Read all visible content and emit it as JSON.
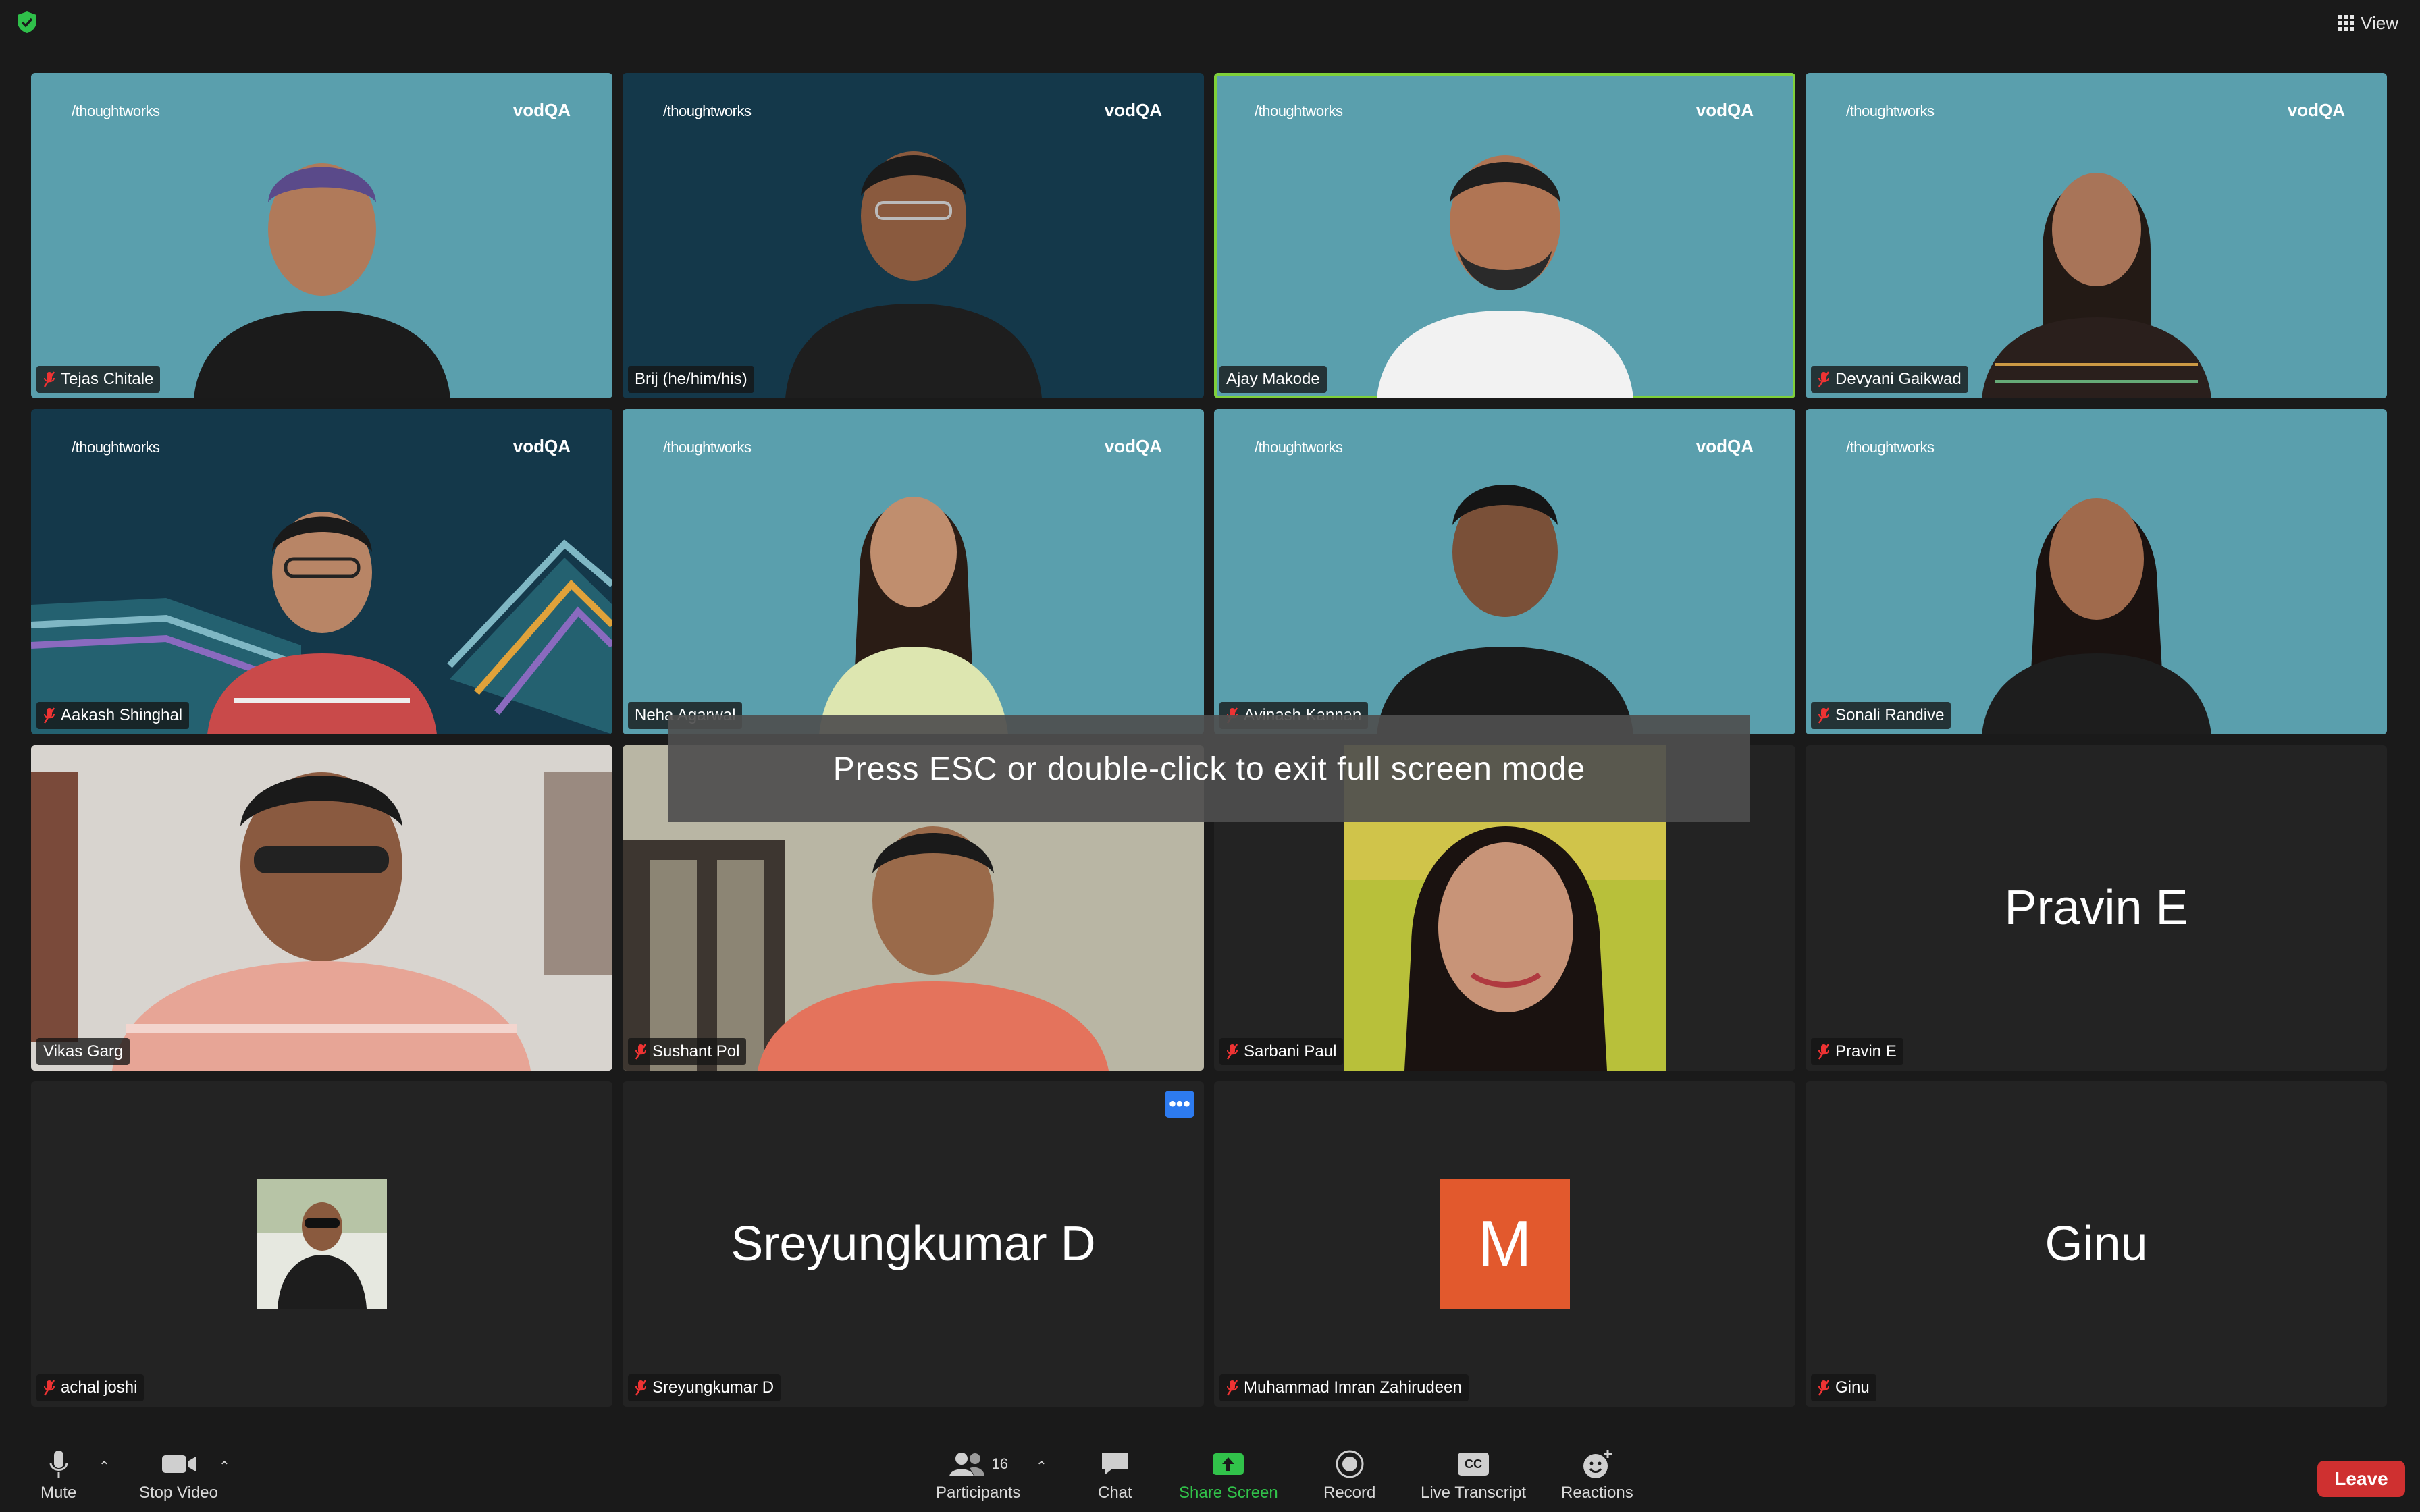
{
  "top": {
    "view_label": "View"
  },
  "branding": {
    "left_logo": "/thoughtworks",
    "right_logo": "vodQA"
  },
  "participants": [
    {
      "name": "Tejas Chitale",
      "muted": true,
      "background": "teal"
    },
    {
      "name": "Brij (he/him/his)",
      "muted": false,
      "background": "navy"
    },
    {
      "name": "Ajay Makode",
      "muted": false,
      "background": "teal",
      "active_speaker": true
    },
    {
      "name": "Devyani Gaikwad",
      "muted": true,
      "background": "teal"
    },
    {
      "name": "Aakash Shinghal",
      "muted": true,
      "background": "navy"
    },
    {
      "name": "Neha Agarwal",
      "muted": false,
      "background": "teal"
    },
    {
      "name": "Avinash Kannan",
      "muted": true,
      "background": "teal"
    },
    {
      "name": "Sonali Randive",
      "muted": true,
      "background": "teal"
    },
    {
      "name": "Vikas Garg",
      "muted": false,
      "background": "camera"
    },
    {
      "name": "Sushant Pol",
      "muted": true,
      "background": "camera"
    },
    {
      "name": "Sarbani Paul",
      "muted": true,
      "background": "photo"
    },
    {
      "name": "Pravin E",
      "muted": true,
      "display": "Pravin E"
    },
    {
      "name": "achal joshi",
      "muted": true,
      "background": "avatar"
    },
    {
      "name": "Sreyungkumar D",
      "muted": true,
      "display": "Sreyungkumar D"
    },
    {
      "name": "Muhammad Imran Zahirudeen",
      "muted": true,
      "avatar_letter": "M"
    },
    {
      "name": "Ginu",
      "muted": true,
      "display": "Ginu"
    }
  ],
  "overlay": {
    "message": "Press ESC or double-click to exit full screen mode"
  },
  "toolbar": {
    "mute": "Mute",
    "stop_video": "Stop Video",
    "participants": "Participants",
    "participant_count": "16",
    "chat": "Chat",
    "share_screen": "Share Screen",
    "record": "Record",
    "live_transcript": "Live Transcript",
    "cc_badge": "CC",
    "reactions": "Reactions",
    "leave": "Leave"
  },
  "more_options_glyph": "•••",
  "colors": {
    "accent_green": "#31c24a",
    "leave_red": "#cf3030",
    "avatar_orange": "#e2592d",
    "more_blue": "#2d7bf0",
    "active_border": "#7fd03a"
  }
}
